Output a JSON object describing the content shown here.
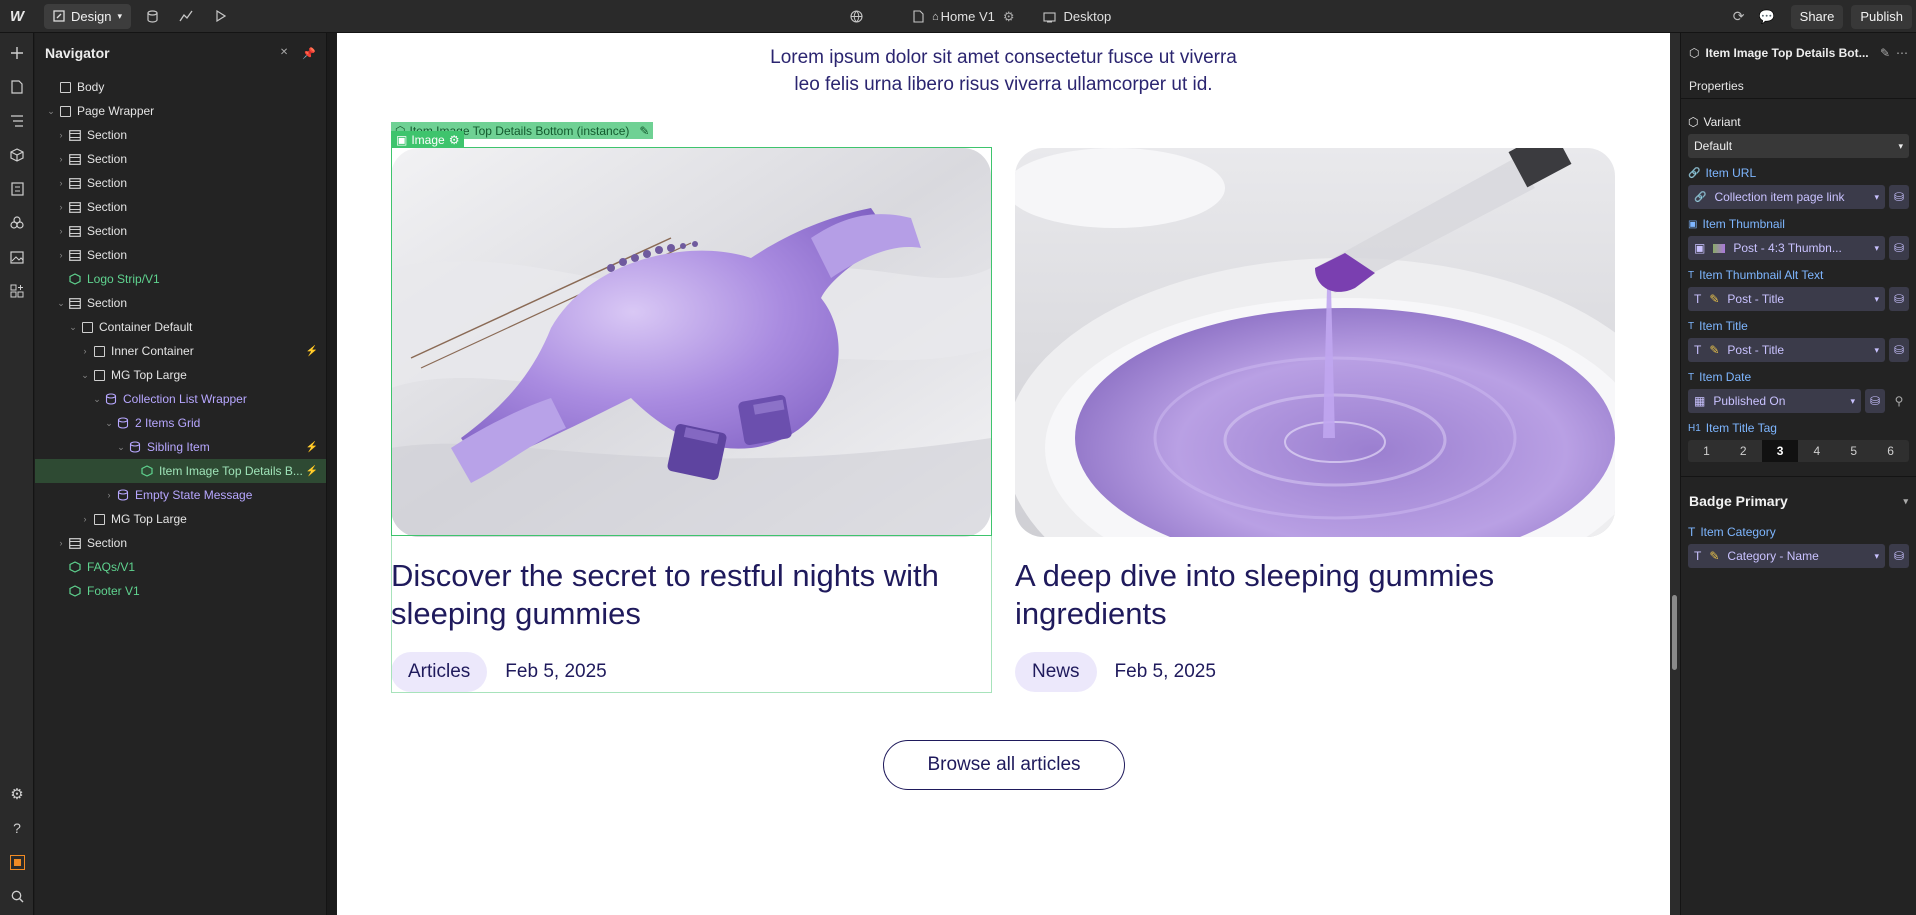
{
  "topbar": {
    "logo": "W",
    "mode_label": "Design",
    "page_label": "Home V1",
    "breakpoint_label": "Desktop",
    "share_label": "Share",
    "publish_label": "Publish"
  },
  "navigator": {
    "title": "Navigator",
    "tree": [
      {
        "label": "Body",
        "depth": 0,
        "caret": "",
        "kind": "box"
      },
      {
        "label": "Page Wrapper",
        "depth": 0,
        "caret": "v",
        "kind": "box"
      },
      {
        "label": "Section",
        "depth": 1,
        "caret": ">",
        "kind": "sec"
      },
      {
        "label": "Section",
        "depth": 1,
        "caret": ">",
        "kind": "sec"
      },
      {
        "label": "Section",
        "depth": 1,
        "caret": ">",
        "kind": "sec"
      },
      {
        "label": "Section",
        "depth": 1,
        "caret": ">",
        "kind": "sec"
      },
      {
        "label": "Section",
        "depth": 1,
        "caret": ">",
        "kind": "sec"
      },
      {
        "label": "Section",
        "depth": 1,
        "caret": ">",
        "kind": "sec"
      },
      {
        "label": "Logo Strip/V1",
        "depth": 1,
        "caret": "",
        "kind": "comp"
      },
      {
        "label": "Section",
        "depth": 1,
        "caret": "v",
        "kind": "sec"
      },
      {
        "label": "Container Default",
        "depth": 2,
        "caret": "v",
        "kind": "cont"
      },
      {
        "label": "Inner Container",
        "depth": 3,
        "caret": ">",
        "kind": "box",
        "tag": "⚡"
      },
      {
        "label": "MG Top Large",
        "depth": 3,
        "caret": "v",
        "kind": "box"
      },
      {
        "label": "Collection List Wrapper",
        "depth": 4,
        "caret": "v",
        "kind": "cms"
      },
      {
        "label": "2 Items Grid",
        "depth": 5,
        "caret": "v",
        "kind": "cms"
      },
      {
        "label": "Sibling Item",
        "depth": 6,
        "caret": "v",
        "kind": "cms",
        "tag": "⚡"
      },
      {
        "label": "Item Image Top Details B...",
        "depth": 7,
        "caret": "",
        "kind": "compsel",
        "selected": true,
        "tag": "⚡"
      },
      {
        "label": "Empty State Message",
        "depth": 5,
        "caret": ">",
        "kind": "cms"
      },
      {
        "label": "MG Top Large",
        "depth": 3,
        "caret": ">",
        "kind": "box"
      },
      {
        "label": "Section",
        "depth": 1,
        "caret": ">",
        "kind": "sec"
      },
      {
        "label": "FAQs/V1",
        "depth": 1,
        "caret": "",
        "kind": "comp"
      },
      {
        "label": "Footer V1",
        "depth": 1,
        "caret": "",
        "kind": "comp"
      }
    ]
  },
  "canvas": {
    "intro_line1": "Lorem ipsum dolor sit amet consectetur fusce ut viverra",
    "intro_line2": "leo felis urna libero risus viverra ullamcorper ut id.",
    "instance_label": "Item Image Top Details Bottom (instance)",
    "image_label": "Image",
    "cards": [
      {
        "title": "Discover the secret to restful nights with sleeping gummies",
        "category": "Articles",
        "date": "Feb 5, 2025"
      },
      {
        "title": "A deep dive into sleeping gummies ingredients",
        "category": "News",
        "date": "Feb 5, 2025"
      }
    ],
    "browse_label": "Browse all articles"
  },
  "right_panel": {
    "component_title": "Item Image Top Details Bot...",
    "tab": "Properties",
    "variant_label": "Variant",
    "variant_value": "Default",
    "props": [
      {
        "label": "Item URL",
        "value": "Collection item page link",
        "icon": "link"
      },
      {
        "label": "Item Thumbnail",
        "value": "Post - 4:3 Thumbn...",
        "icon": "image"
      },
      {
        "label": "Item Thumbnail Alt Text",
        "value": "Post - Title",
        "icon": "text"
      },
      {
        "label": "Item Title",
        "value": "Post - Title",
        "icon": "text"
      },
      {
        "label": "Item Date",
        "value": "Published On",
        "icon": "text"
      }
    ],
    "title_tag_label": "Item Title Tag",
    "title_tag_options": [
      "1",
      "2",
      "3",
      "4",
      "5",
      "6"
    ],
    "title_tag_selected": "3",
    "badge_section": "Badge Primary",
    "badge_prop_label": "Item Category",
    "badge_prop_value": "Category - Name"
  },
  "colors": {
    "accent_green": "#3ec46d",
    "cms_purple": "#b7a7ff",
    "heading_navy": "#1f1a5c",
    "badge_bg": "#ece8fb"
  }
}
